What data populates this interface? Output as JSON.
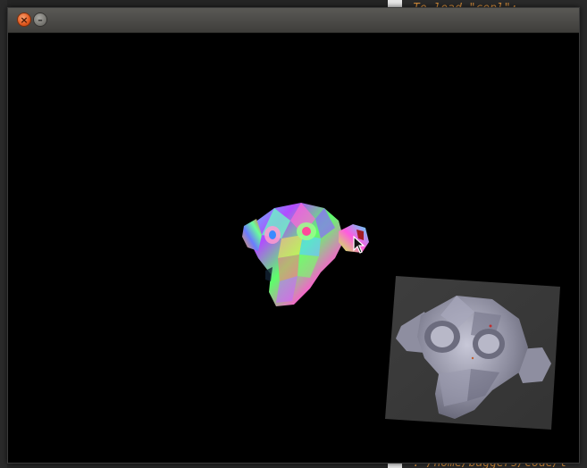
{
  "editor": {
    "top_line": "To load \"cepl\":",
    "bottom_line": ": /home/baggers/Code/l"
  },
  "gl_window": {
    "close_glyph": "×",
    "minimize_glyph": "–"
  },
  "icons": {
    "close": "close-icon",
    "minimize": "minimize-icon",
    "cursor": "mouse-pointer-icon"
  },
  "colors": {
    "close_button": "#e1581e",
    "titlebar": "#4d4c48",
    "viewport": "#000000",
    "editor_accent": "#d08a3a"
  }
}
